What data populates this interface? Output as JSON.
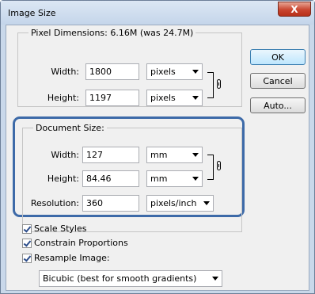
{
  "window": {
    "title": "Image Size",
    "close_label": "X"
  },
  "pixel_dimensions": {
    "label": "Pixel Dimensions:  6.16M (was 24.7M)",
    "width_label": "Width:",
    "width_value": "1800",
    "width_unit": "pixels",
    "height_label": "Height:",
    "height_value": "1197",
    "height_unit": "pixels"
  },
  "buttons": {
    "ok": "OK",
    "cancel": "Cancel",
    "auto": "Auto..."
  },
  "document_size": {
    "label": "Document Size:",
    "width_label": "Width:",
    "width_value": "127",
    "width_unit": "mm",
    "height_label": "Height:",
    "height_value": "84.46",
    "height_unit": "mm",
    "resolution_label": "Resolution:",
    "resolution_value": "360",
    "resolution_unit": "pixels/inch"
  },
  "options": {
    "scale_styles": "Scale Styles",
    "constrain_proportions": "Constrain Proportions",
    "resample_image": "Resample Image:",
    "resample_method": "Bicubic (best for smooth gradients)"
  },
  "colors": {
    "highlight": "#3d6aa8",
    "titlebar": "#c4d5ea",
    "close": "#c9452f"
  }
}
